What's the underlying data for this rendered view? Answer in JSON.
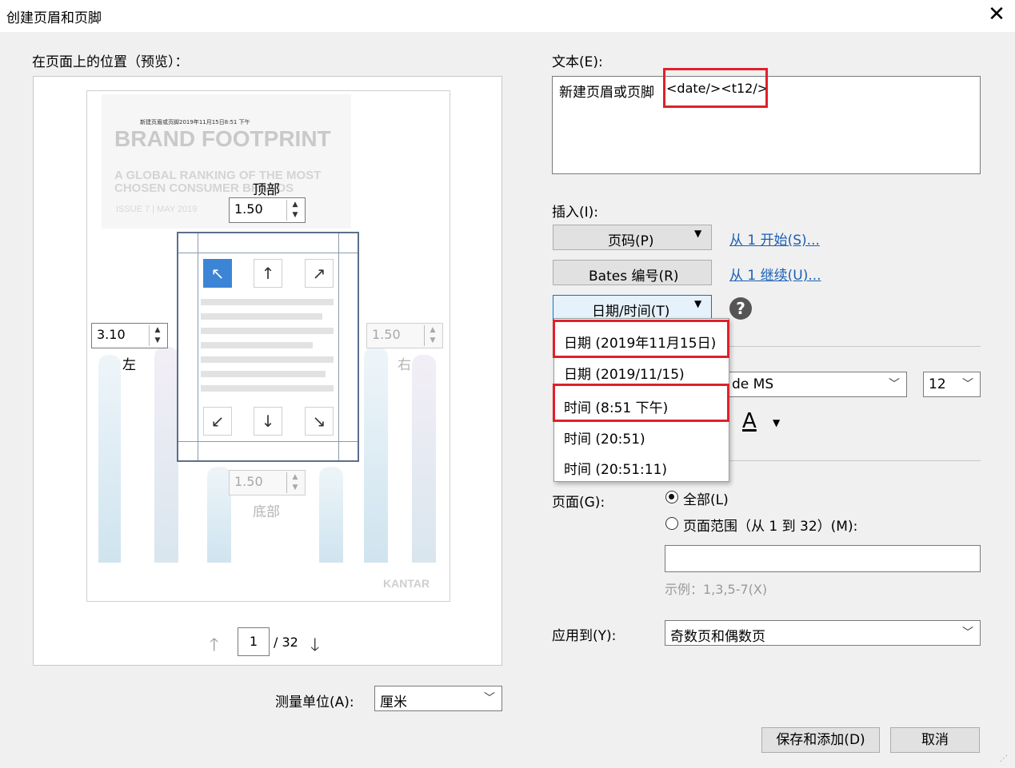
{
  "window": {
    "title": "创建页眉和页脚",
    "close_glyph": "✕"
  },
  "preview": {
    "label": "在页面上的位置（预览）：",
    "thumbnail": {
      "header_text": "新建页眉或页脚2019年11月15日8:51 下午",
      "brand_title": "BRAND FOOTPRINT",
      "sub_line1": "A GLOBAL RANKING OF THE MOST",
      "sub_line2": "CHOSEN CONSUMER BRANDS",
      "issue": "ISSUE 7  |  MAY 2019",
      "logo": "KANTAR"
    },
    "top_margin": {
      "label": "顶部",
      "value": "1.50"
    },
    "left_margin": {
      "label": "左",
      "value": "3.10"
    },
    "right_margin": {
      "label": "右",
      "value": "1.50"
    },
    "bottom_margin": {
      "label": "底部",
      "value": "1.50"
    },
    "pager": {
      "current": "1",
      "total": "/ 32"
    }
  },
  "units": {
    "label": "测量单位(A):",
    "value": "厘米"
  },
  "text_section": {
    "label": "文本(E):",
    "plain": "新建页眉或页脚",
    "tags": "<date/><t12/>"
  },
  "insert": {
    "label": "插入(I):",
    "page_number": "页码(P)",
    "bates": "Bates 编号(R)",
    "datetime": "日期/时间(T)",
    "from1": "从 1 开始(S)...",
    "continue1": "从 1 继续(U)..."
  },
  "dropdown_options": [
    "日期 (2019年11月15日)",
    "日期 (2019/11/15)",
    "时间 (8:51 下午)",
    "时间 (20:51)",
    "时间 (20:51:11)"
  ],
  "font": {
    "name_partial": "de MS",
    "size": "12",
    "color_letter": "A"
  },
  "pages": {
    "label": "页面(G):",
    "all": "全部(L)",
    "range": "页面范围（从 1 到 32）(M):",
    "example": "示例：1,3,5-7(X)"
  },
  "apply": {
    "label": "应用到(Y):",
    "value": "奇数页和偶数页"
  },
  "buttons": {
    "save_add": "保存和添加(D)",
    "cancel": "取消"
  },
  "colors": {
    "highlight": "#e0202b",
    "selected_position": "#3c85d6",
    "link": "#1a5fb4"
  }
}
